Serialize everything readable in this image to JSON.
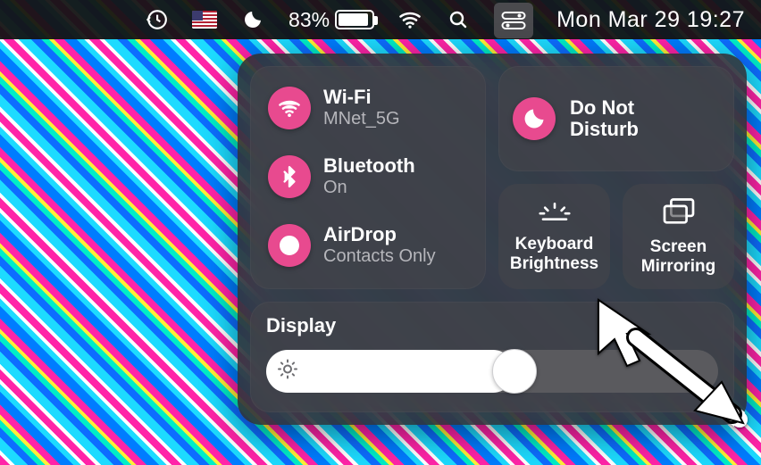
{
  "menubar": {
    "battery_pct": "83%",
    "date_time": "Mon Mar 29  19:27"
  },
  "controlCenter": {
    "wifi": {
      "title": "Wi-Fi",
      "sub": "MNet_5G"
    },
    "bluetooth": {
      "title": "Bluetooth",
      "sub": "On"
    },
    "airdrop": {
      "title": "AirDrop",
      "sub": "Contacts Only"
    },
    "dnd": {
      "title_l1": "Do Not",
      "title_l2": "Disturb"
    },
    "keyboard": {
      "label_l1": "Keyboard",
      "label_l2": "Brightness"
    },
    "mirroring": {
      "label_l1": "Screen",
      "label_l2": "Mirroring"
    },
    "display": {
      "heading": "Display",
      "value_pct": 55
    }
  },
  "colors": {
    "accent": "#e84a8f"
  }
}
